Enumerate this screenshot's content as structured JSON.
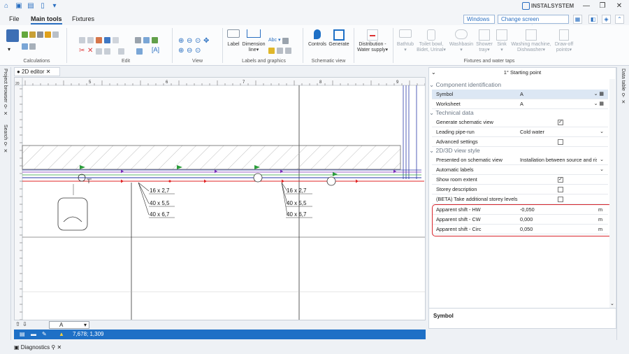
{
  "window": {
    "brand": "INSTALSYSTEM",
    "controls": [
      "—",
      "❐",
      "✕"
    ]
  },
  "ribbon_tabs": [
    "File",
    "Main tools",
    "Fixtures"
  ],
  "top_right": {
    "windows_label": "Windows",
    "arrangement_label": "Change screen arrangement"
  },
  "ribbon": {
    "groups": {
      "calculations": "Calculations",
      "edit": "Edit",
      "view": "View",
      "labels": "Labels and graphics",
      "schematic": "Schematic view",
      "fixtures": "Fixtures and water taps"
    },
    "buttons": {
      "label": "Label",
      "dimension": "Dimension",
      "dimension2": "line",
      "controls": "Controls",
      "generate": "Generate",
      "distribution": "Distribution -",
      "distribution2": "Water supply",
      "bathtub": "Bathtub",
      "toilet": "Toilet bowl,",
      "toilet2": "Bidet, Urinal",
      "washbasin": "Washbasin",
      "shower": "Shower",
      "shower2": "tray",
      "sink": "Sink",
      "washing": "Washing machine,",
      "washing2": "Dishwasher",
      "drawoff": "Draw-off",
      "drawoff2": "points"
    }
  },
  "left_panel": {
    "project_browser": "Project browser",
    "search": "Search"
  },
  "editor": {
    "tab_label": "● 2D editor",
    "ruler_labels": [
      "5",
      "6",
      "7",
      "8",
      "9"
    ],
    "ruler_corner": "20",
    "dim_labels": [
      "16 x 2,7",
      "40 x 5,5",
      "40 x 6,7",
      "16 x 2,7",
      "40 x 5,5",
      "40 x 6,7"
    ],
    "layer_select": "A",
    "coords": "7,678; 1,309"
  },
  "bottom_panel": {
    "diagnostics": "Diagnostics"
  },
  "right_strip": {
    "data_table": "Data table"
  },
  "properties": {
    "header": "1° Starting point",
    "sections": {
      "component_identification": "Component identification",
      "technical_data": "Technical data",
      "view_style": "2D/3D view style"
    },
    "rows": {
      "symbol": {
        "label": "Symbol",
        "value": "A"
      },
      "worksheet": {
        "label": "Worksheet",
        "value": "A"
      },
      "generate_schematic": {
        "label": "Generate schematic view",
        "checked": true
      },
      "leading_pipe": {
        "label": "Leading pipe-run",
        "value": "Cold water"
      },
      "advanced": {
        "label": "Advanced settings",
        "checked": false
      },
      "presented": {
        "label": "Presented on schematic view",
        "value": "Installation between source and riser"
      },
      "auto_labels": {
        "label": "Automatic labels",
        "value": ""
      },
      "room_extent": {
        "label": "Show room extent",
        "checked": true
      },
      "storey_desc": {
        "label": "Storey description",
        "checked": false
      },
      "beta_storey": {
        "label": "(BETA) Take additional storey levels into account",
        "checked": false
      },
      "shift_hw": {
        "label": "Apparent shift - HW",
        "value": "-0,050",
        "unit": "m"
      },
      "shift_cw": {
        "label": "Apparent shift - CW",
        "value": "0,000",
        "unit": "m"
      },
      "shift_circ": {
        "label": "Apparent shift - Circ",
        "value": "0,050",
        "unit": "m"
      }
    },
    "description_title": "Symbol"
  },
  "colors": {
    "accent": "#1e70c6",
    "highlight": "#d9272e",
    "hot_pipe": "#e02424",
    "circ_pipe": "#7b2fb8",
    "fitting": "#2a9d3a"
  }
}
